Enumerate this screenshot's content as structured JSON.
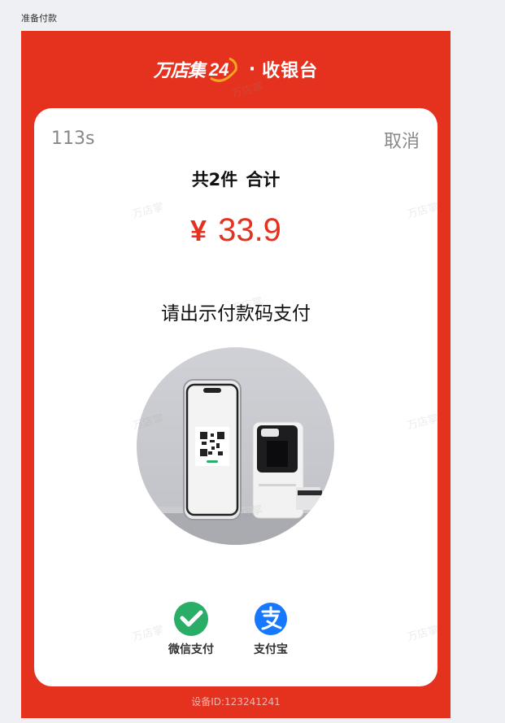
{
  "page": {
    "label": "准备付款"
  },
  "brand": {
    "name": "万店集",
    "logo_number": "24",
    "separator": "·",
    "title": "收银台"
  },
  "order": {
    "countdown": "113s",
    "cancel_label": "取消",
    "items_count_text": "共2件",
    "total_label": "合计",
    "currency_symbol": "¥",
    "total_amount": "33.9"
  },
  "instruction": "请出示付款码支付",
  "payment_methods": [
    {
      "label": "微信支付",
      "icon": "wechat-pay-icon",
      "color": "#2aae67"
    },
    {
      "label": "支付宝",
      "icon": "alipay-icon",
      "color": "#1677ff"
    }
  ],
  "footer": {
    "device_id": "设备ID:123241241"
  },
  "watermark": {
    "text": "万店掌"
  },
  "colors": {
    "brand_red": "#e5321f",
    "card_bg": "#ffffff",
    "page_bg": "#eff0f3"
  }
}
